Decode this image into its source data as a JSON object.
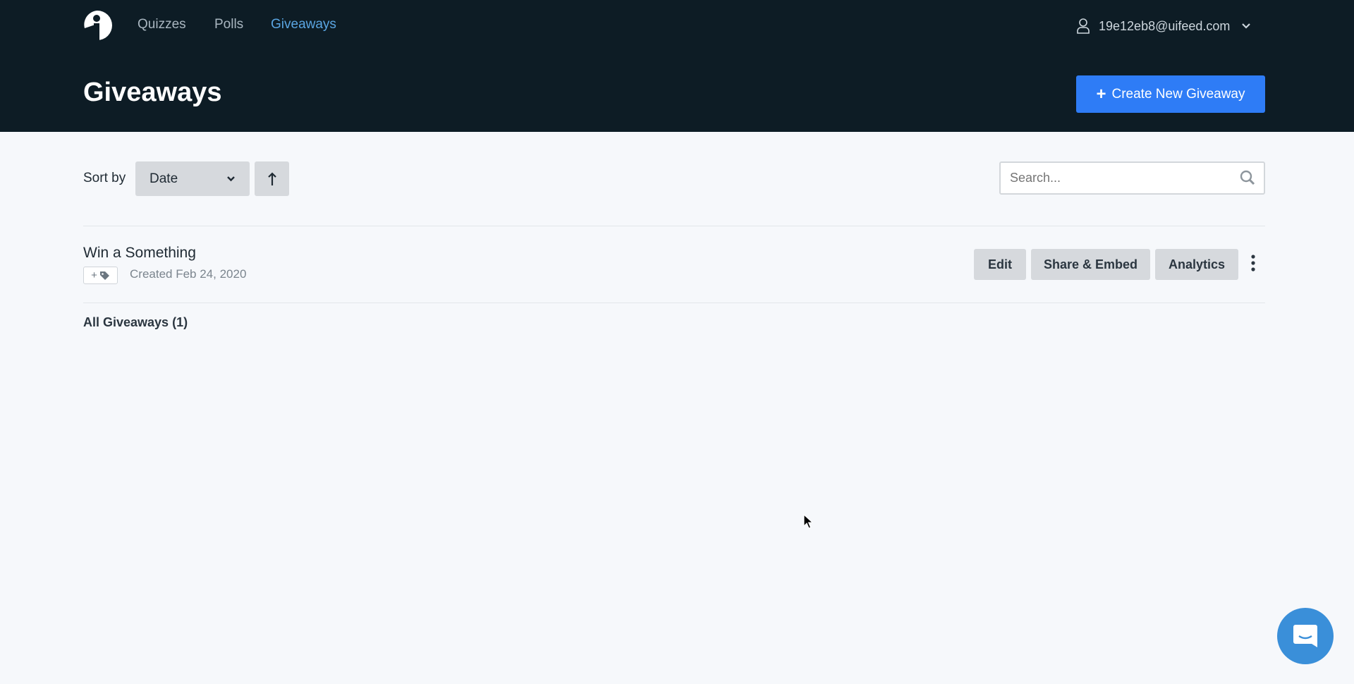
{
  "nav": {
    "items": [
      {
        "label": "Quizzes"
      },
      {
        "label": "Polls"
      },
      {
        "label": "Giveaways",
        "active": true
      }
    ],
    "user_email": "19e12eb8@uifeed.com"
  },
  "header": {
    "title": "Giveaways",
    "create_button": "Create New Giveaway"
  },
  "toolbar": {
    "sort_label": "Sort by",
    "sort_value": "Date",
    "sort_direction": "ascending",
    "search_placeholder": "Search..."
  },
  "giveaways": [
    {
      "title": "Win a Something",
      "tag_button": "+",
      "created": "Created Feb 24, 2020",
      "actions": [
        "Edit",
        "Share & Embed",
        "Analytics"
      ]
    }
  ],
  "footer_count": "All Giveaways (1)",
  "colors": {
    "header_bg": "#0d1c25",
    "accent": "#2e7cf6",
    "active_nav": "#5aa5e2",
    "chat": "#3a8fd9"
  }
}
